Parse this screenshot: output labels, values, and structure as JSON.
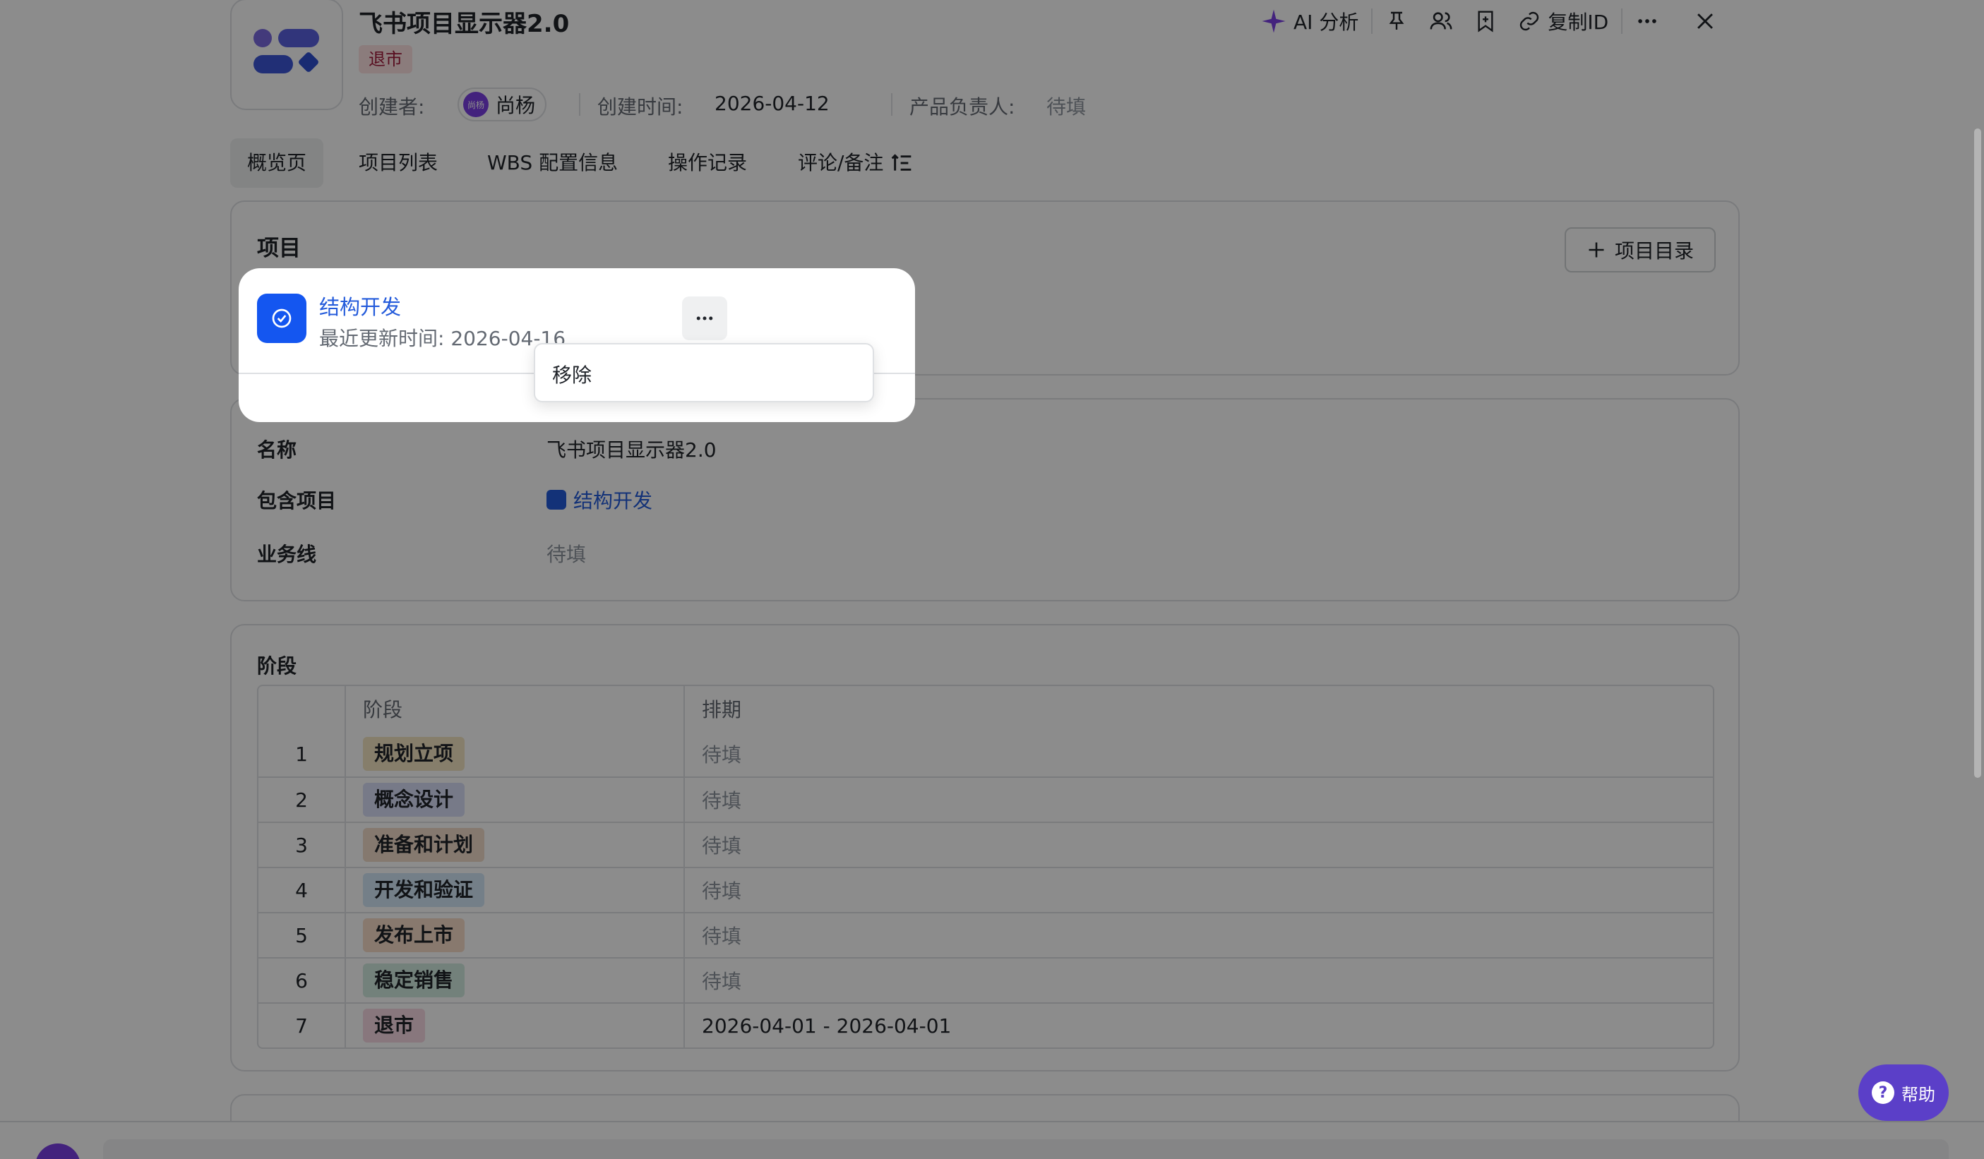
{
  "header": {
    "title": "飞书项目显示器2.0",
    "status_tag": "退市",
    "creator_label": "创建者:",
    "creator_name": "尚杨",
    "creator_avatar_text": "尚杨",
    "created_time_label": "创建时间:",
    "created_time": "2026-04-12",
    "owner_label": "产品负责人:",
    "owner_value": "待填"
  },
  "toolbar": {
    "ai_label": "AI 分析",
    "copy_id_label": "复制ID",
    "icons": [
      "sparkle-icon",
      "pin-icon",
      "people-icon",
      "bookmark-icon",
      "link-icon",
      "more-icon",
      "close-icon"
    ]
  },
  "tabs": [
    {
      "label": "概览页",
      "active": true
    },
    {
      "label": "项目列表",
      "active": false
    },
    {
      "label": "WBS 配置信息",
      "active": false
    },
    {
      "label": "操作记录",
      "active": false
    },
    {
      "label": "评论/备注",
      "active": false
    }
  ],
  "projects_card": {
    "title": "项目",
    "add_button": "项目目录",
    "item": {
      "name": "结构开发",
      "updated": "最近更新时间: 2026-04-16"
    },
    "menu": {
      "items": [
        "移除"
      ]
    }
  },
  "info_card": {
    "name_label": "名称",
    "name_value": "飞书项目显示器2.0",
    "projects_label": "包含项目",
    "projects_value": "结构开发",
    "business_label": "业务线",
    "business_value": "待填"
  },
  "phases_card": {
    "title": "阶段",
    "columns": [
      "阶段",
      "排期"
    ],
    "rows": [
      {
        "index": "1",
        "phase": "规划立项",
        "color": "#f5e6c4",
        "schedule": "待填",
        "pending": true
      },
      {
        "index": "2",
        "phase": "概念设计",
        "color": "#d9def8",
        "schedule": "待填",
        "pending": true
      },
      {
        "index": "3",
        "phase": "准备和计划",
        "color": "#f3ddcb",
        "schedule": "待填",
        "pending": true
      },
      {
        "index": "4",
        "phase": "开发和验证",
        "color": "#d3e8f8",
        "schedule": "待填",
        "pending": true
      },
      {
        "index": "5",
        "phase": "发布上市",
        "color": "#f8dcc9",
        "schedule": "待填",
        "pending": true
      },
      {
        "index": "6",
        "phase": "稳定销售",
        "color": "#d2ece0",
        "schedule": "待填",
        "pending": true
      },
      {
        "index": "7",
        "phase": "退市",
        "color": "#f8d9e3",
        "schedule": "2026-04-01 - 2026-04-01",
        "pending": false
      }
    ]
  },
  "help": {
    "label": "帮助"
  }
}
